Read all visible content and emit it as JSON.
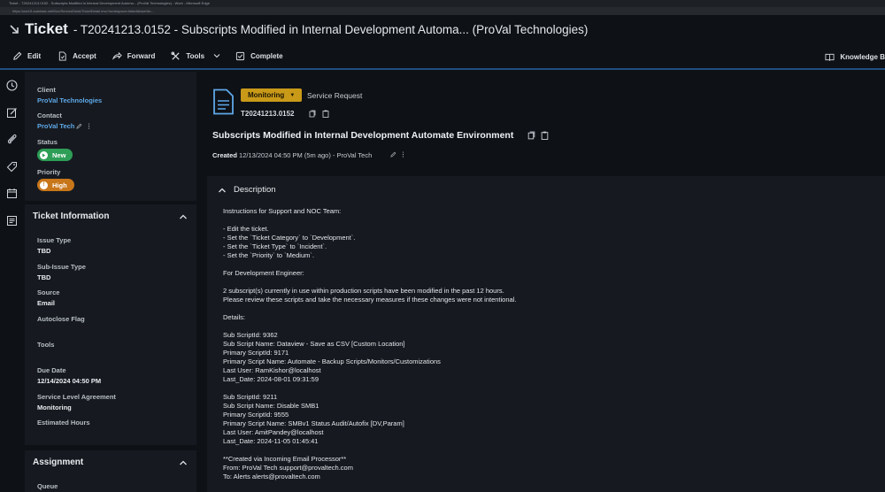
{
  "browser": {
    "title_bar": "Ticket - T20241213.0152 - Subscripts Modified in Internal Development Automa... (ProVal Technologies) - Work - Microsoft Edge",
    "url": "https://ww15.autotask.net/Mvc/ServiceDesk/TicketDetail.mvc?workspace=false&ticketId=..."
  },
  "header": {
    "title": "Ticket",
    "subtitle": "- T20241213.0152 - Subscripts Modified in Internal Development Automa... (ProVal Technologies)"
  },
  "toolbar": {
    "edit": "Edit",
    "accept": "Accept",
    "forward": "Forward",
    "tools": "Tools",
    "complete": "Complete",
    "knowledge": "Knowledge B"
  },
  "left": {
    "client_label": "Client",
    "client_value": "ProVal Technologies",
    "contact_label": "Contact",
    "contact_value": "ProVal Tech",
    "status_label": "Status",
    "status_value": "New",
    "priority_label": "Priority",
    "priority_value": "High",
    "priority_mark": "!",
    "ticket_info_title": "Ticket Information",
    "issue_type_label": "Issue Type",
    "issue_type_value": "TBD",
    "sub_issue_label": "Sub-Issue Type",
    "sub_issue_value": "TBD",
    "source_label": "Source",
    "source_value": "Email",
    "autoclose_label": "Autoclose Flag",
    "tools_label": "Tools",
    "due_label": "Due Date",
    "due_value": "12/14/2024 04:50 PM",
    "sla_label": "Service Level Agreement",
    "sla_value": "Monitoring",
    "est_label": "Estimated Hours",
    "assignment_title": "Assignment",
    "queue_label": "Queue"
  },
  "main": {
    "tag": "Monitoring",
    "category": "Service Request",
    "ticket_number": "T20241213.0152",
    "title": "Subscripts Modified in Internal Development Automate Environment",
    "created_label": "Created",
    "created_value": "12/13/2024 04:50 PM (5m ago)",
    "created_by": "- ProVal Tech",
    "description_title": "Description",
    "description_lines": [
      "Instructions for Support and NOC Team:",
      "",
      "- Edit the ticket.",
      "- Set the `Ticket Category` to `Development`.",
      "- Set the `Ticket Type` to `Incident`.",
      "- Set the `Priority` to `Medium`.",
      "",
      "For Development Engineer:",
      "",
      "2 subscript(s) currently in use within production scripts have been modified in the past 12 hours.",
      "Please review these scripts and take the necessary measures if these changes were not intentional.",
      "",
      "Details:",
      "",
      "Sub ScriptId: 9362",
      "Sub Script Name: Dataview - Save as CSV [Custom Location]",
      "Primary ScriptId: 9171",
      "Primary Script Name: Automate - Backup Scripts/Monitors/Customizations",
      "Last User: RamKishor@localhost",
      "Last_Date: 2024-08-01 09:31:59",
      "",
      "Sub ScriptId: 9211",
      "Sub Script Name: Disable SMB1",
      "Primary ScriptId: 9555",
      "Primary Script Name: SMBv1 Status Audit/Autofix [DV,Param]",
      "Last User: AmitPandey@localhost",
      "Last_Date: 2024-11-05 01:45:41",
      "",
      "**Created via Incoming Email Processor**",
      "From: ProVal Tech support@provaltech.com",
      "To: Alerts alerts@provaltech.com"
    ]
  },
  "colors": {
    "accent_link": "#5fa8e8",
    "status_new": "#2e9e57",
    "priority_high": "#c8761a",
    "tag_monitoring": "#c99a18",
    "toolbar_underline": "#1f4d80"
  }
}
